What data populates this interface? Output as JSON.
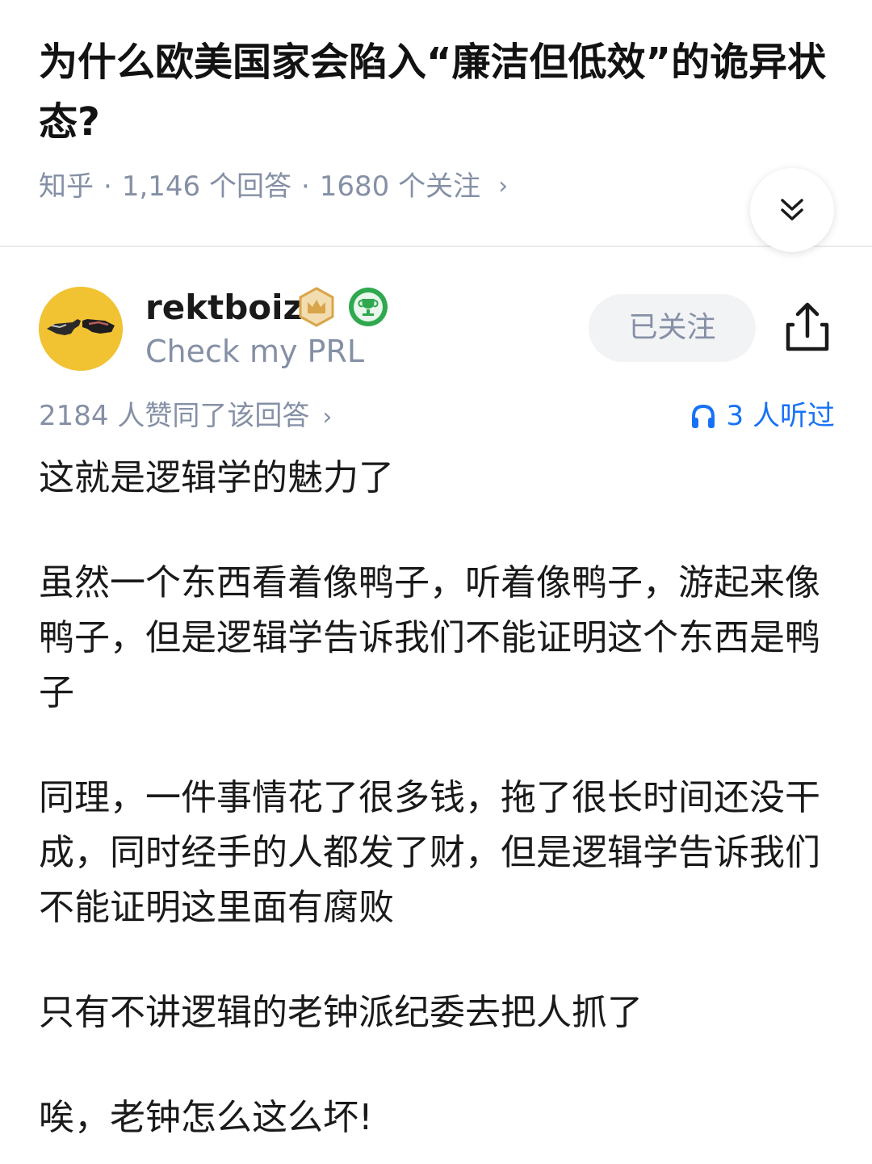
{
  "question": {
    "title": "为什么欧美国家会陷入“廉洁但低效”的诡异状态?",
    "source": "知乎",
    "answers_count": "1,146 个回答",
    "followers_count": "1680 个关注",
    "separator": "·",
    "chevron": "›"
  },
  "author": {
    "name": "rektboiz",
    "bio": "Check my PRL",
    "badges": [
      "crown-badge-icon",
      "trophy-badge-icon"
    ],
    "follow_label": "已关注"
  },
  "stats": {
    "votes": "2184 人赞同了该回答",
    "chevron": "›",
    "listeners": "3 人听过"
  },
  "answer": {
    "paragraphs": [
      "这就是逻辑学的魅力了",
      "虽然一个东西看着像鸭子，听着像鸭子，游起来像鸭子，但是逻辑学告诉我们不能证明这个东西是鸭子",
      "同理，一件事情花了很多钱，拖了很长时间还没干成，同时经手的人都发了财，但是逻辑学告诉我们不能证明这里面有腐败",
      "只有不讲逻辑的老钟派纪委去把人抓了",
      "唉，老钟怎么这么坏!"
    ]
  },
  "colors": {
    "accent": "#1772f6",
    "muted": "#8590a6",
    "avatar_bg": "#f1c232"
  }
}
